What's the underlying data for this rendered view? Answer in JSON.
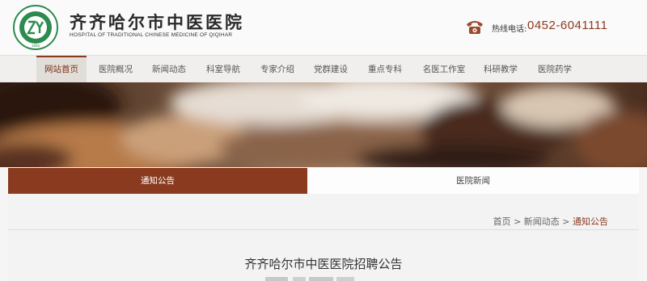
{
  "header": {
    "title": "齐齐哈尔市中医医院",
    "subtitle": "HOSPITAL OF TRADITIONAL CHINESE MEDICINE OF QIQIHAR",
    "logo": {
      "initials": "ZY",
      "year": "1955"
    },
    "hotline_label": "热线电话:",
    "hotline_number": "0452-6041111"
  },
  "nav": {
    "items": [
      {
        "label": "网站首页",
        "active": true
      },
      {
        "label": "医院概况"
      },
      {
        "label": "新闻动态"
      },
      {
        "label": "科室导航"
      },
      {
        "label": "专家介绍"
      },
      {
        "label": "党群建设"
      },
      {
        "label": "重点专科"
      },
      {
        "label": "名医工作室"
      },
      {
        "label": "科研教学"
      },
      {
        "label": "医院药学"
      }
    ]
  },
  "tabs": {
    "notice": "通知公告",
    "news": "医院新闻"
  },
  "breadcrumb": {
    "home": "首页",
    "sep": ">",
    "section": "新闻动态",
    "current": "通知公告"
  },
  "article": {
    "title": "齐齐哈尔市中医医院招聘公告"
  },
  "colors": {
    "accent": "#8a3a1f",
    "nav_bg": "#f0efed",
    "page_bg": "#f3f3f3"
  },
  "icons": {
    "phone": "telephone-icon"
  }
}
